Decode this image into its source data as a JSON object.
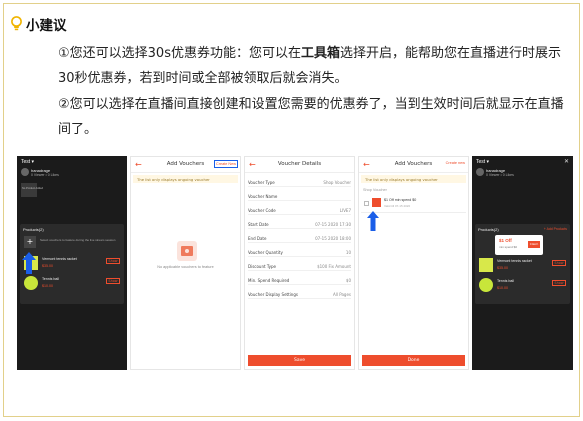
{
  "tip": {
    "title": "小建议",
    "para1_before": "①您还可以选择30s优惠券功能：您可以在",
    "para1_bold": "工具箱",
    "para1_after": "选择开启，能帮助您在直播进行时展示30秒优惠券，若到时间或全部被领取后就会消失。",
    "para2": "②您可以选择在直播间直接创建和设置您需要的优惠券了，当到生效时间后就显示在直播间了。"
  },
  "colors": {
    "accent": "#ee4d2d",
    "arrow": "#1a5ee8",
    "border": "#e2d08a",
    "bulb": "#f0b400"
  },
  "screens": {
    "s1": {
      "header": "Test ▾",
      "host": "hanadrage",
      "stats": "0 Viewer • 0 Likes",
      "no_product": "No Product Added",
      "products_label": "Products(2)",
      "add_hint": "Select vouchers to feature during the live stream session",
      "item1": "Vermont tennis racket",
      "item1_price": "$35.00",
      "item2": "Tennis ball",
      "item2_price": "$10.00",
      "action": "Show"
    },
    "s2": {
      "title": "Add Vouchers",
      "link": "Create New",
      "banner": "The list only displays ongoing voucher",
      "empty": "No applicable vouchers to feature"
    },
    "s3": {
      "title": "Voucher Details",
      "rows": [
        {
          "k": "Voucher Type",
          "v": "Shop Voucher"
        },
        {
          "k": "Voucher Name",
          "v": ""
        },
        {
          "k": "Voucher Code",
          "v": "LIVE7"
        },
        {
          "k": "Start Date",
          "v": "07-15 2020 17:30"
        },
        {
          "k": "End Date",
          "v": "07-15 2020 18:00"
        },
        {
          "k": "Voucher Quantity",
          "v": "10"
        },
        {
          "k": "Discount Type",
          "v": "$100 Fix Amount"
        },
        {
          "k": "Min. Spend Required",
          "v": "$0"
        },
        {
          "k": "Voucher Display Settings",
          "v": "All Pages"
        }
      ],
      "button": "Save"
    },
    "s4": {
      "title": "Add Vouchers",
      "link": "Create new",
      "banner": "The list only displays ongoing voucher",
      "section": "Shop Voucher",
      "voucher": "$1 Off min spend $0",
      "voucher_sub": "Valid till 07-15 2020",
      "button": "Done"
    },
    "s5": {
      "header": "Test ▾",
      "host": "hanadrage",
      "stats": "0 Viewer • 0 Likes",
      "products_label": "Products(2)",
      "add_link": "+ Add Products",
      "voucher_title": "$1 Off",
      "voucher_desc": "min spend $0",
      "voucher_btn": "Claim",
      "item1": "Vermont tennis racket",
      "item1_price": "$35.00",
      "item2": "Tennis ball",
      "item2_price": "$10.00",
      "action": "Show"
    }
  }
}
